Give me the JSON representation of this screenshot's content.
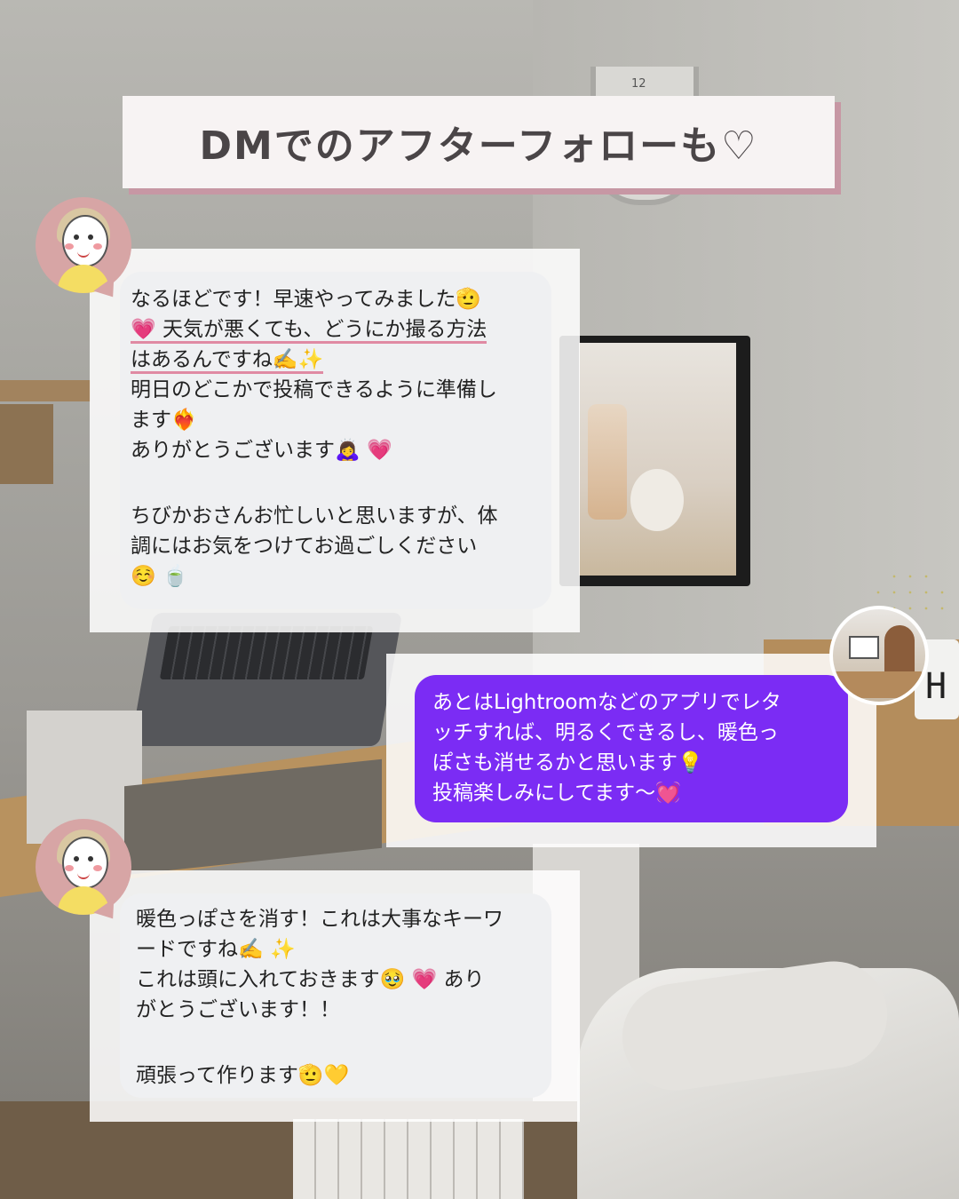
{
  "title": "DMでのアフターフォローも♡",
  "background": {
    "clock_number": "12",
    "cup_letter": "H"
  },
  "avatars": {
    "left_icon": "woman-illustration-avatar",
    "right_icon": "desk-photo-avatar"
  },
  "messages": [
    {
      "sender": "left",
      "lines": [
        "なるほどです！早速やってみました🫡",
        "💗 天気が悪くても、どうにか撮る方法",
        "はあるんですね✍️✨",
        "明日のどこかで投稿できるように準備し",
        "ます❤️‍🔥",
        "ありがとうございます🙇‍♀️ 💗",
        "",
        "ちびかおさんお忙しいと思いますが、体",
        "調にはお気をつけてお過ごしください",
        "☺️ 🍵"
      ],
      "underlined": [
        "天気が悪くても、どうにか撮る方法",
        "はあるんですね"
      ]
    },
    {
      "sender": "right",
      "lines": [
        "あとはLightroomなどのアプリでレタ",
        "ッチすれば、明るくできるし、暖色っ",
        "ぽさも消せるかと思います💡",
        "投稿楽しみにしてます〜💓"
      ]
    },
    {
      "sender": "left",
      "lines": [
        "暖色っぽさを消す！これは大事なキーワ",
        "ードですね✍️ ✨",
        "これは頭に入れておきます🥹 💗 あり",
        "がとうございます！！",
        "",
        "頑張って作ります🫡💛"
      ]
    }
  ],
  "colors": {
    "title_bg": "#f7f3f3",
    "title_shadow": "#c797a4",
    "title_text": "#4a4547",
    "bubble_grey": "#eff0f2",
    "bubble_purple": "#7b2cf4",
    "avatar_bg": "#d7a5a5",
    "underline": "#e08aa3"
  }
}
